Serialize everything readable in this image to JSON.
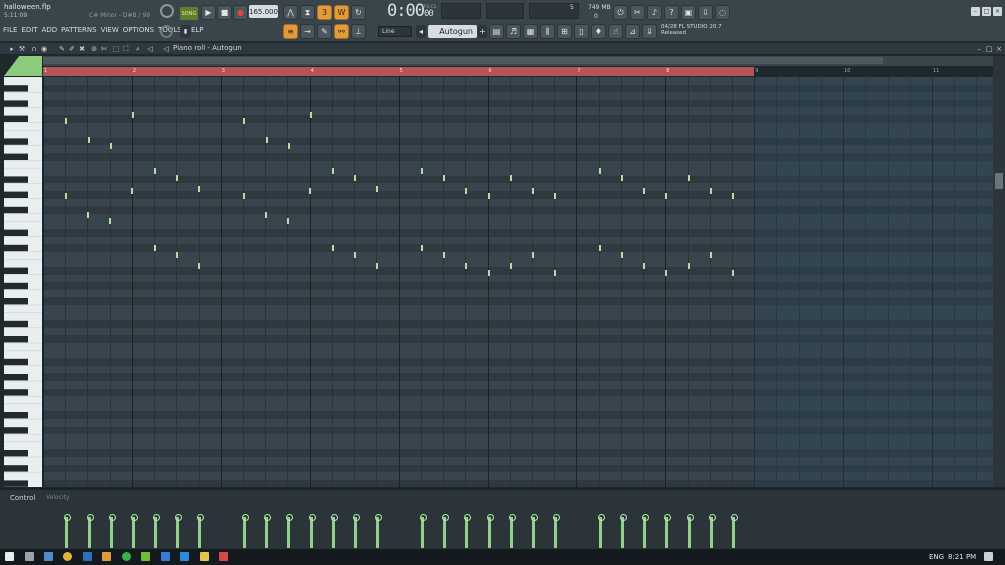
{
  "project": {
    "filename": "halloween.flp",
    "elapsed": "5:11:09",
    "key_info": "C# Minor - D#B / 99"
  },
  "menu": [
    "FILE",
    "EDIT",
    "ADD",
    "PATTERNS",
    "VIEW",
    "OPTIONS",
    "TOOLS",
    "HELP"
  ],
  "transport": {
    "mode_label": "SONG",
    "tempo": "165.000",
    "time_main": "0:00",
    "time_sub": "00",
    "time_unit": "M:S:CS"
  },
  "monitor": {
    "cpu_value": "5",
    "memory": "749 MB",
    "voices": "0"
  },
  "news": {
    "line1": "04/28  FL STUDIO 20.7",
    "line2": "Released"
  },
  "snap": {
    "value": "Line"
  },
  "pattern": {
    "name": "Autogun"
  },
  "piano_roll": {
    "title": "Piano roll - Autogun"
  },
  "bars": [
    "1",
    "2",
    "3",
    "4",
    "5",
    "6",
    "7",
    "8",
    "9",
    "10",
    "11"
  ],
  "control": {
    "label": "Control",
    "sub": "Velocity"
  },
  "taskbar": {
    "language": "ENG",
    "time": "8:21 PM"
  },
  "colors": {
    "note": "#aee0a4",
    "loop_bar": "#b55458",
    "accent": "#e39a3b"
  }
}
